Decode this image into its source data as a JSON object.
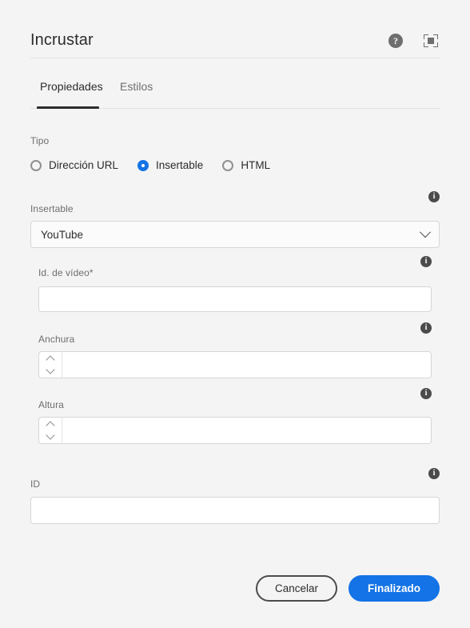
{
  "dialog": {
    "title": "Incrustar",
    "help_icon": "help-circle-icon",
    "fullscreen_icon": "fullscreen-icon"
  },
  "tabs": [
    {
      "label": "Propiedades",
      "active": true
    },
    {
      "label": "Estilos",
      "active": false
    }
  ],
  "type_section": {
    "label": "Tipo",
    "options": [
      {
        "label": "Dirección URL",
        "selected": false
      },
      {
        "label": "Insertable",
        "selected": true
      },
      {
        "label": "HTML",
        "selected": false
      }
    ]
  },
  "embeddable": {
    "label": "Insertable",
    "value": "YouTube",
    "placeholder": "",
    "chevron_icon": "chevron-down-icon",
    "info_icon": "info-icon"
  },
  "video_id": {
    "label": "Id. de vídeo",
    "required_mark": "*",
    "value": "",
    "placeholder": "",
    "info_icon": "info-icon"
  },
  "width": {
    "label": "Anchura",
    "value": "",
    "placeholder": "",
    "increment_icon": "chevron-up-icon",
    "decrement_icon": "chevron-down-icon",
    "info_icon": "info-icon"
  },
  "height": {
    "label": "Altura",
    "value": "",
    "placeholder": "",
    "increment_icon": "chevron-up-icon",
    "decrement_icon": "chevron-down-icon",
    "info_icon": "info-icon"
  },
  "id_field": {
    "label": "ID",
    "value": "",
    "placeholder": "",
    "info_icon": "info-icon"
  },
  "footer": {
    "cancel_label": "Cancelar",
    "confirm_label": "Finalizado"
  },
  "colors": {
    "accent": "#1473e6",
    "background": "#f4f4f4",
    "text": "#2c2c2c",
    "muted_text": "#6e6e6e",
    "border": "#d6d6d6"
  },
  "glyphs": {
    "help": "?",
    "info": "i"
  }
}
